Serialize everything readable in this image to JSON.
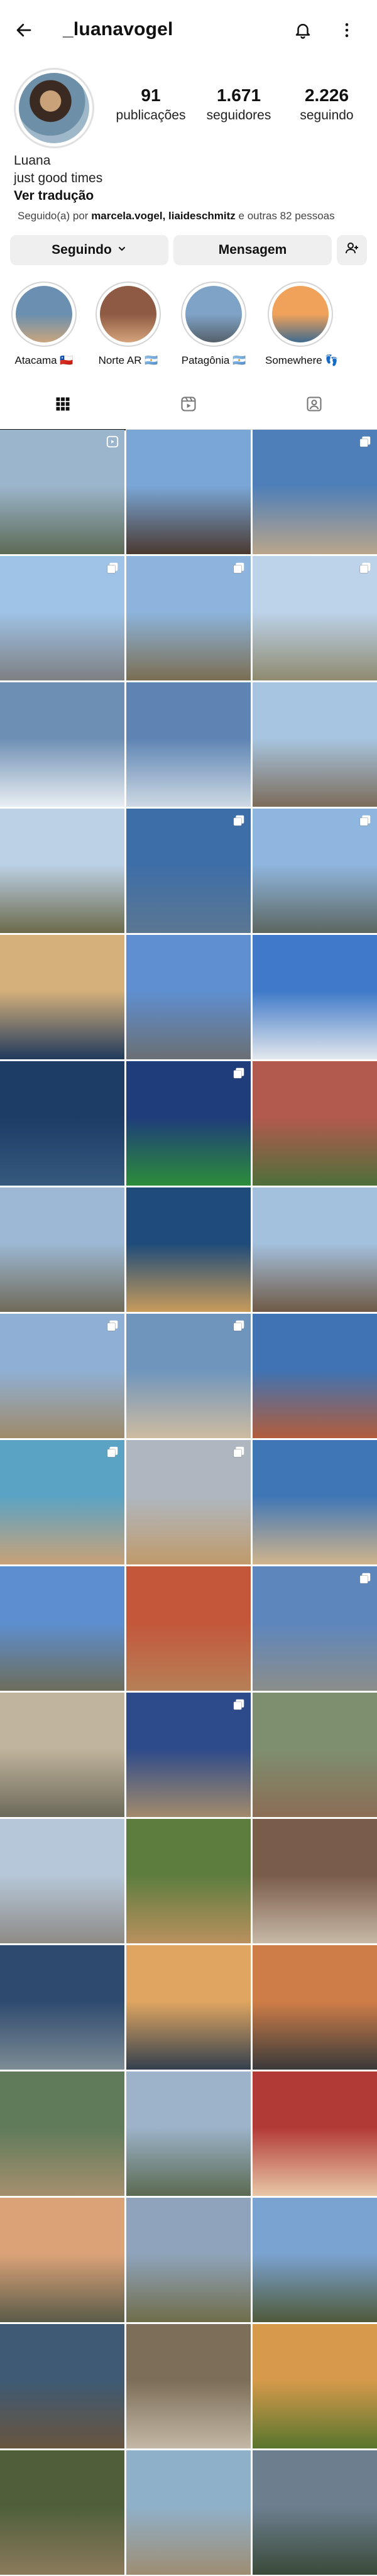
{
  "header": {
    "username": "_luanavogel",
    "back_icon": "arrow-left-icon",
    "notifications_icon": "bell-icon",
    "more_icon": "more-vertical-icon"
  },
  "stats": [
    {
      "value": "91",
      "label": "publicações"
    },
    {
      "value": "1.671",
      "label": "seguidores"
    },
    {
      "value": "2.226",
      "label": "seguindo"
    }
  ],
  "bio": {
    "name": "Luana",
    "tagline": "just good times",
    "translate": "Ver tradução"
  },
  "followed_by": {
    "prefix": "Seguido(a) por ",
    "users": "marcela.vogel, liaideschmitz",
    "suffix": " e outras 82 pessoas"
  },
  "actions": {
    "following": "Seguindo",
    "message": "Mensagem"
  },
  "highlights": [
    {
      "label": "Atacama 🇨🇱",
      "colors": [
        "#6a8fb0",
        "#c9a57d"
      ]
    },
    {
      "label": "Norte AR 🇦🇷",
      "colors": [
        "#8f5a43",
        "#d4a37c"
      ]
    },
    {
      "label": "Patagônia 🇦🇷",
      "colors": [
        "#7fa3c7",
        "#55606a"
      ]
    },
    {
      "label": "Somewhere 👣",
      "colors": [
        "#f1a25a",
        "#3e6b8f"
      ]
    }
  ],
  "tabs": [
    "grid-icon",
    "reels-icon",
    "tagged-icon"
  ],
  "colors": {
    "button_bg": "#efefef",
    "divider": "#dbdbdb"
  },
  "posts": [
    {
      "c1": "#9bb5cc",
      "c2": "#5c6a55",
      "badge": "reel"
    },
    {
      "c1": "#7aa6d6",
      "c2": "#4a3a30",
      "badge": ""
    },
    {
      "c1": "#4f7fb8",
      "c2": "#b9a58b",
      "badge": "multi"
    },
    {
      "c1": "#9fc3e6",
      "c2": "#7d7f82",
      "badge": "multi"
    },
    {
      "c1": "#8db4dc",
      "c2": "#7a6e52",
      "badge": "multi"
    },
    {
      "c1": "#bcd3ea",
      "c2": "#8f8a6f",
      "badge": "multi"
    },
    {
      "c1": "#6e8fb4",
      "c2": "#e9eef3",
      "badge": ""
    },
    {
      "c1": "#5e84b3",
      "c2": "#cdd9e4",
      "badge": ""
    },
    {
      "c1": "#a7c5e0",
      "c2": "#7c6c5a",
      "badge": ""
    },
    {
      "c1": "#bcd1e6",
      "c2": "#6b6a4a",
      "badge": ""
    },
    {
      "c1": "#3e6ea8",
      "c2": "#5b7792",
      "badge": "multi"
    },
    {
      "c1": "#8fb6de",
      "c2": "#5c6660",
      "badge": "multi"
    },
    {
      "c1": "#d4b07a",
      "c2": "#203a5c",
      "badge": ""
    },
    {
      "c1": "#5f8fd0",
      "c2": "#6a6f74",
      "badge": ""
    },
    {
      "c1": "#3f79c8",
      "c2": "#e3e8ed",
      "badge": ""
    },
    {
      "c1": "#1d3c66",
      "c2": "#36597e",
      "badge": ""
    },
    {
      "c1": "#1f3d7a",
      "c2": "#2c8d3b",
      "badge": "multi"
    },
    {
      "c1": "#b25a4d",
      "c2": "#4f6f3a",
      "badge": ""
    },
    {
      "c1": "#9cb8d4",
      "c2": "#6f6a58",
      "badge": ""
    },
    {
      "c1": "#1e4b7a",
      "c2": "#c79b5a",
      "badge": ""
    },
    {
      "c1": "#a3c0dd",
      "c2": "#6f5a46",
      "badge": ""
    },
    {
      "c1": "#8fb0d4",
      "c2": "#9e8a6a",
      "badge": "multi"
    },
    {
      "c1": "#6f95bd",
      "c2": "#cdbba0",
      "badge": "multi"
    },
    {
      "c1": "#3f73b4",
      "c2": "#b25d3c",
      "badge": ""
    },
    {
      "c1": "#5aa3c4",
      "c2": "#c9a178",
      "badge": "multi"
    },
    {
      "c1": "#aeb7c0",
      "c2": "#c09a6b",
      "badge": "multi"
    },
    {
      "c1": "#3f76b6",
      "c2": "#d0b48c",
      "badge": ""
    },
    {
      "c1": "#5d8fd0",
      "c2": "#6d6d5b",
      "badge": ""
    },
    {
      "c1": "#c4573a",
      "c2": "#b68057",
      "badge": ""
    },
    {
      "c1": "#5d86bd",
      "c2": "#8b8e8a",
      "badge": "multi"
    },
    {
      "c1": "#c1b49d",
      "c2": "#6c6a5a",
      "badge": ""
    },
    {
      "c1": "#2d4a8a",
      "c2": "#a28b6c",
      "badge": "multi"
    },
    {
      "c1": "#7e8f6f",
      "c2": "#8b6d55",
      "badge": ""
    },
    {
      "c1": "#b6c7d9",
      "c2": "#8d8b86",
      "badge": ""
    },
    {
      "c1": "#5d7d3f",
      "c2": "#b9905e",
      "badge": ""
    },
    {
      "c1": "#7a5c4a",
      "c2": "#c7b8a6",
      "badge": ""
    },
    {
      "c1": "#2e4a6e",
      "c2": "#7d8c95",
      "badge": ""
    },
    {
      "c1": "#e0a560",
      "c2": "#33404e",
      "badge": ""
    },
    {
      "c1": "#cf7d47",
      "c2": "#3a3a3a",
      "badge": ""
    },
    {
      "c1": "#5f7b5a",
      "c2": "#a58f6e",
      "badge": ""
    },
    {
      "c1": "#9cb3c9",
      "c2": "#5b6a52",
      "badge": ""
    },
    {
      "c1": "#b23a36",
      "c2": "#e8c7a7",
      "badge": ""
    },
    {
      "c1": "#dba278",
      "c2": "#5a5c48",
      "badge": ""
    },
    {
      "c1": "#8fa4bc",
      "c2": "#6f6d4a",
      "badge": ""
    },
    {
      "c1": "#7ba3d1",
      "c2": "#4f5a3a",
      "badge": ""
    },
    {
      "c1": "#3e5a74",
      "c2": "#68553f",
      "badge": ""
    },
    {
      "c1": "#7c6e58",
      "c2": "#c4b8a6",
      "badge": ""
    },
    {
      "c1": "#d69a4a",
      "c2": "#58752e",
      "badge": ""
    },
    {
      "c1": "#4e5f3a",
      "c2": "#8b7a5c",
      "badge": ""
    },
    {
      "c1": "#8fb0c9",
      "c2": "#9e8d73",
      "badge": ""
    },
    {
      "c1": "#6d7f8f",
      "c2": "#3a4a3a",
      "badge": ""
    }
  ]
}
